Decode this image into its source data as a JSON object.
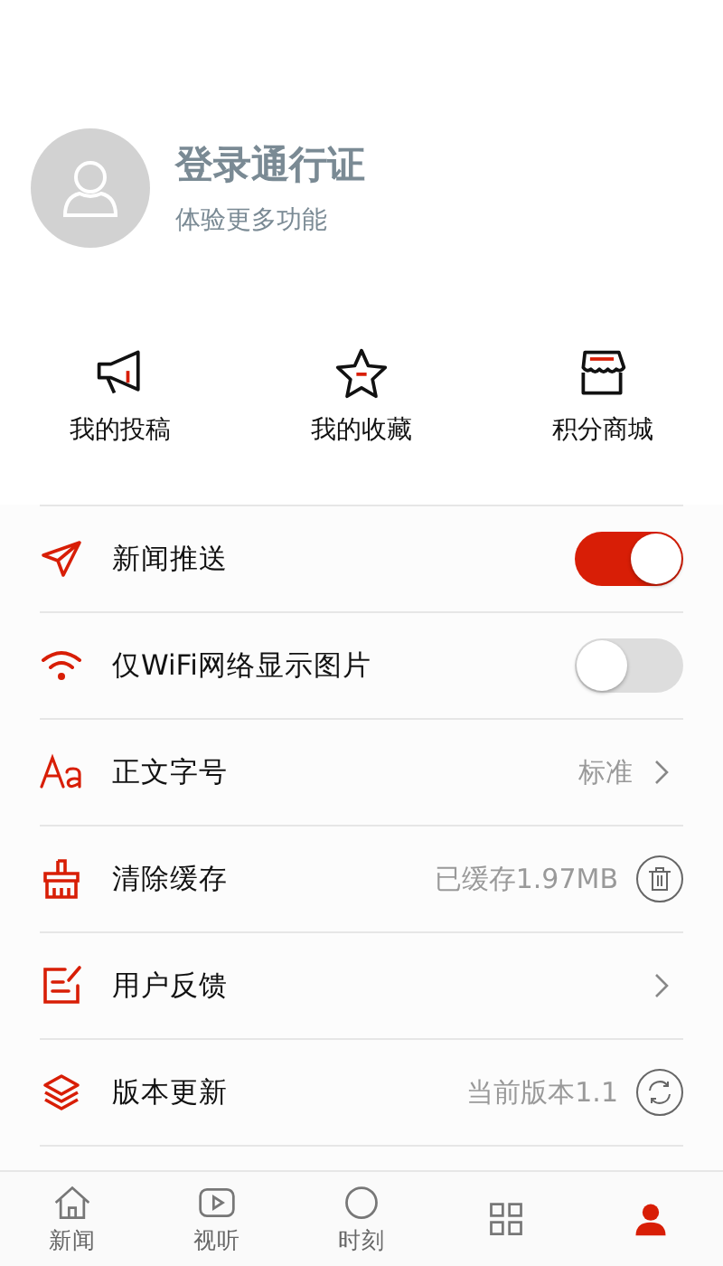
{
  "profile": {
    "title": "登录通行证",
    "subtitle": "体验更多功能"
  },
  "shortcuts": [
    {
      "label": "我的投稿"
    },
    {
      "label": "我的收藏"
    },
    {
      "label": "积分商城"
    }
  ],
  "settings": [
    {
      "label": "新闻推送",
      "kind": "toggle",
      "on": true
    },
    {
      "label": "仅WiFi网络显示图片",
      "kind": "toggle",
      "on": false
    },
    {
      "label": "正文字号",
      "kind": "link",
      "value": "标准"
    },
    {
      "label": "清除缓存",
      "kind": "trash",
      "value": "已缓存1.97MB"
    },
    {
      "label": "用户反馈",
      "kind": "link"
    },
    {
      "label": "版本更新",
      "kind": "refresh",
      "value": "当前版本1.1"
    }
  ],
  "tabs": [
    {
      "label": "新闻",
      "selected": false
    },
    {
      "label": "视听",
      "selected": false
    },
    {
      "label": "时刻",
      "selected": false
    },
    {
      "selected": false
    },
    {
      "selected": true
    }
  ]
}
